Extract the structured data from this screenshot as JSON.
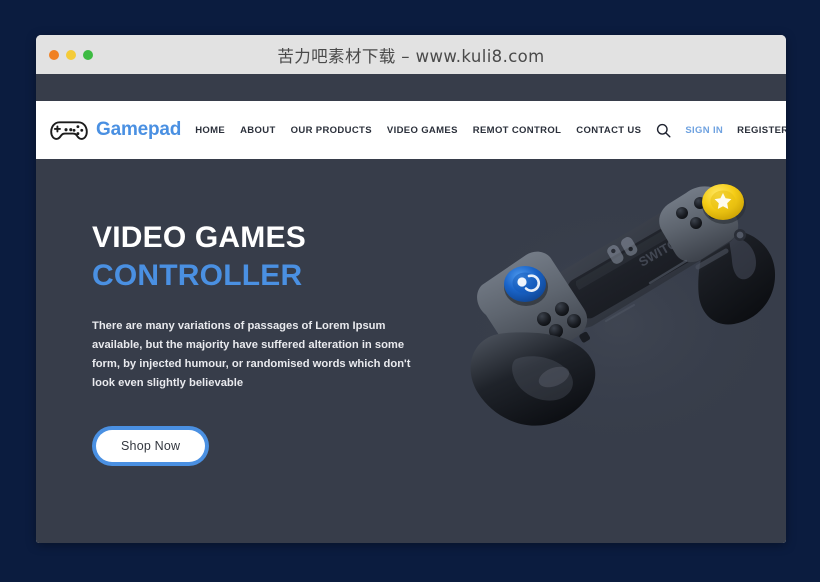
{
  "window": {
    "title": "苦力吧素材下载 – www.kuli8.com",
    "traffic_lights": [
      {
        "name": "close",
        "color": "#f08123"
      },
      {
        "name": "minimize",
        "color": "#f4cb38"
      },
      {
        "name": "maximize",
        "color": "#3dbb42"
      }
    ]
  },
  "site": {
    "brand": {
      "icon": "gamepad-icon",
      "name": "Gamepad"
    },
    "nav_links": [
      {
        "label": "HOME"
      },
      {
        "label": "ABOUT"
      },
      {
        "label": "OUR PRODUCTS"
      },
      {
        "label": "VIDEO GAMES"
      },
      {
        "label": "REMOT CONTROL"
      },
      {
        "label": "CONTACT US"
      }
    ],
    "search_icon": "search-icon",
    "sign_in": "SIGN IN",
    "register": "REGISTER"
  },
  "hero": {
    "title_line_1": "VIDEO GAMES",
    "title_line_2": "CONTROLLER",
    "paragraph": "There are many variations of passages of Lorem Ipsum available, but the majority have suffered alteration in some form, by injected humour, or randomised words which don't look even slightly believable",
    "cta_label": "Shop Now",
    "product_image": "game-controller-image"
  },
  "colors": {
    "page_background": "#0b1c3f",
    "titlebar": "#e2e2e2",
    "hero_background": "#373d4a",
    "accent_blue": "#4a90e2",
    "signin_blue": "#6fa2e0",
    "text_dark": "#2b303b",
    "stick_blue": "#1a64c8",
    "stick_yellow": "#f5cd17"
  }
}
